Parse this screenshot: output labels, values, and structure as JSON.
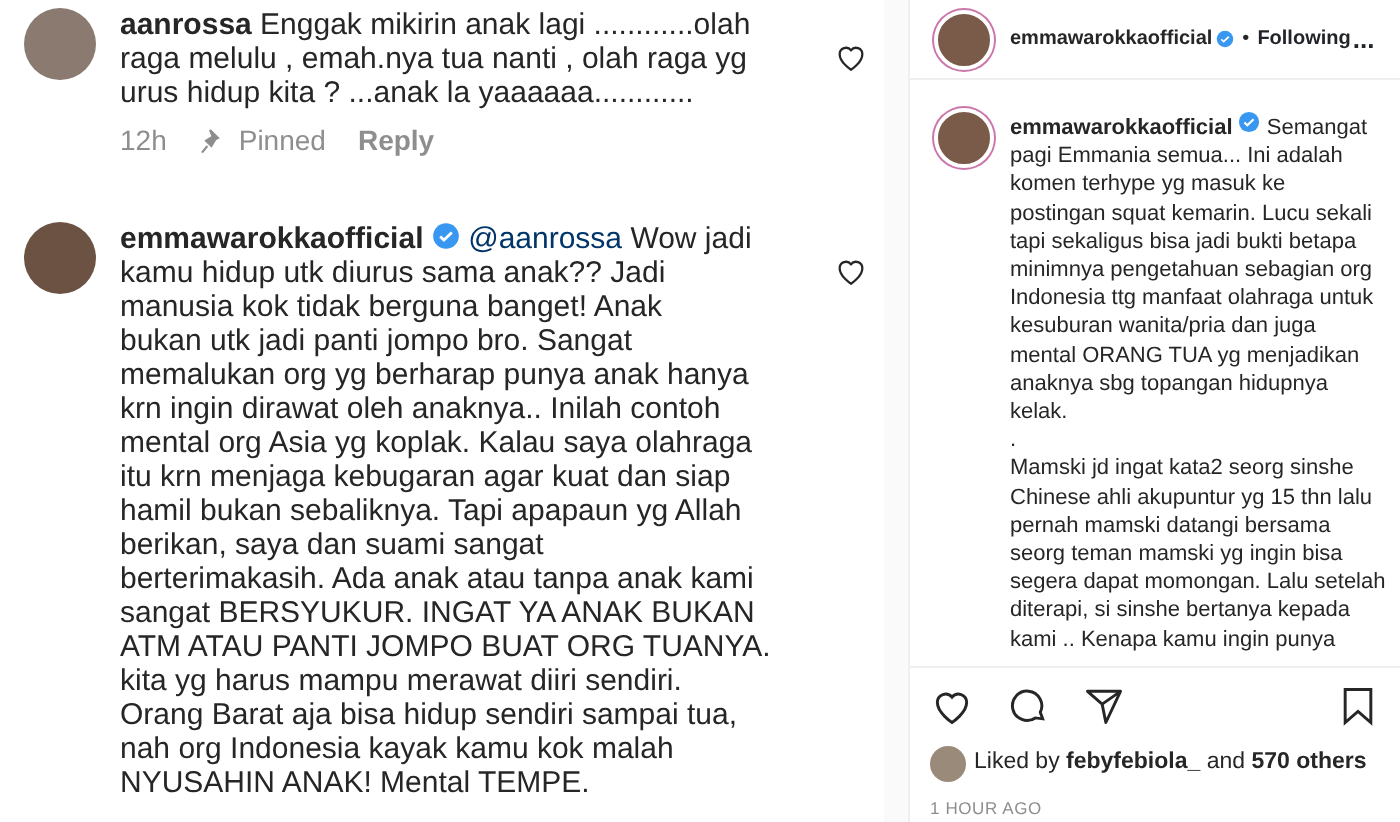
{
  "comments": [
    {
      "username": "aanrossa",
      "verified": false,
      "text": "Enggak mikirin anak lagi ............olah\nraga melulu , emah.nya tua nanti , olah raga yg\nurus  hidup kita ? ...anak la yaaaaaa............",
      "time": "12h",
      "pinned_label": "Pinned",
      "reply_label": "Reply",
      "liked": false
    },
    {
      "username": "emmawarokkaofficial",
      "verified": true,
      "mention": "@aanrossa",
      "text": " Wow jadi\nkamu hidup utk diurus sama anak?? Jadi\nmanusia kok tidak berguna banget!  Anak\nbukan utk jadi panti jompo bro.  Sangat\nmemalukan org yg berharap punya anak hanya\nkrn ingin dirawat oleh anaknya.. Inilah contoh\nmental org Asia yg koplak. Kalau saya olahraga\nitu krn menjaga kebugaran agar kuat dan siap\nhamil bukan sebaliknya. Tapi apapaun yg Allah\nberikan,  saya dan suami sangat\nberterimakasih. Ada anak atau tanpa anak kami\nsangat BERSYUKUR.  INGAT YA ANAK BUKAN\nATM ATAU PANTI JOMPO BUAT ORG TUANYA.\nkita yg harus mampu merawat diiri sendiri.\nOrang Barat aja bisa hidup sendiri sampai tua,\nnah org Indonesia kayak kamu kok malah\nNYUSAHIN ANAK!  Mental TEMPE.",
      "liked": false
    }
  ],
  "post": {
    "username": "emmawarokkaofficial",
    "verified": true,
    "separator": "•",
    "follow_status": "Following",
    "more": "...",
    "caption_username": "emmawarokkaofficial",
    "caption_verified": true,
    "caption": "Semangat\npagi Emmania semua... Ini adalah\nkomen terhype yg masuk ke\npostingan squat kemarin. Lucu sekali\ntapi sekaligus bisa jadi bukti betapa\nminimnya pengetahuan sebagian org\nIndonesia ttg manfaat olahraga untuk\nkesuburan wanita/pria dan juga\nmental ORANG TUA yg menjadikan\nanaknya sbg topangan hidupnya\nkelak.\n.\nMamski jd ingat kata2 seorg sinshe\nChinese ahli akupuntur yg 15 thn lalu\npernah mamski datangi bersama\nseorg teman mamski yg ingin bisa\nsegera dapat momongan. Lalu setelah\nditerapi, si sinshe bertanya kepada\nkami .. Kenapa kamu ingin punya",
    "liked": false,
    "saved": false,
    "likes_text": "Liked by **febyfebiola_** and **570 others**",
    "time": "1 HOUR AGO"
  }
}
